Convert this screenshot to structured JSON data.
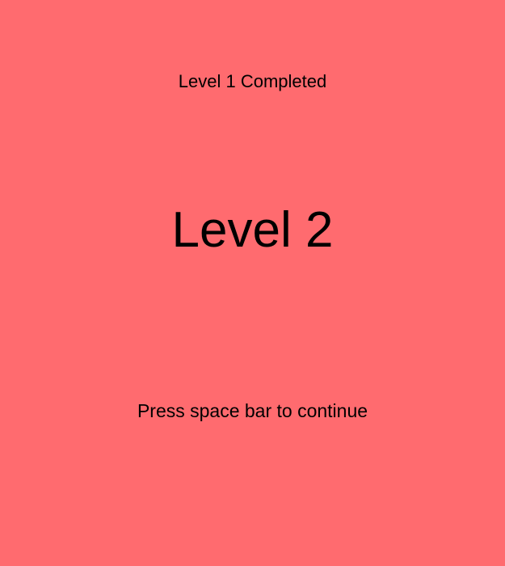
{
  "screen": {
    "background_color": "#ff6b6f",
    "text_color": "#000000",
    "completed_text": "Level 1 Completed",
    "next_level_text": "Level 2",
    "continue_prompt": "Press space bar to continue"
  }
}
